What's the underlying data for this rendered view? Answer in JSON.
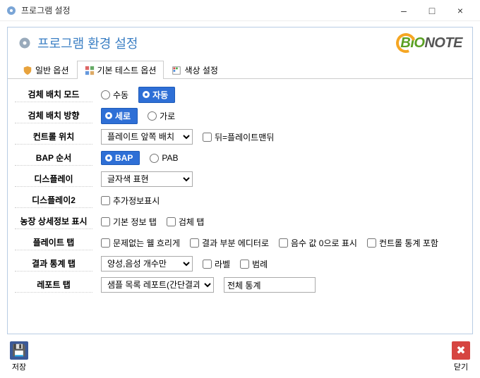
{
  "window": {
    "title": "프로그램 설정",
    "minimize": "–",
    "maximize": "□",
    "close": "×"
  },
  "header": {
    "title": "프로그램 환경 설정",
    "logo_bio": "BIO",
    "logo_note": "NOTE"
  },
  "tabs": {
    "general": "일반 옵션",
    "basic_test": "기본 테스트 옵션",
    "color": "색상 설정"
  },
  "form": {
    "placement_mode": {
      "label": "검체 배치 모드",
      "manual": "수동",
      "auto": "자동"
    },
    "placement_dir": {
      "label": "검체 배치 방향",
      "vertical": "세로",
      "horizontal": "가로"
    },
    "control_pos": {
      "label": "컨트롤 위치",
      "selected": "플레이트 앞쪽 배치",
      "options": [
        "플레이트 앞쪽 배치"
      ],
      "back_chk": "뒤=플레이트맨뒤"
    },
    "bap_order": {
      "label": "BAP 순서",
      "bap": "BAP",
      "pab": "PAB"
    },
    "display": {
      "label": "디스플레이",
      "selected": "글자색 표현",
      "options": [
        "글자색 표현"
      ]
    },
    "display2": {
      "label": "디스플레이2",
      "extra": "추가정보표시"
    },
    "farm_detail": {
      "label": "농장 상세정보 표시",
      "basic": "기본 정보 탭",
      "sample": "검체 탭"
    },
    "plate_tab": {
      "label": "플레이트 탭",
      "blur": "문제없는 웰 흐리게",
      "editor": "결과 부분 에디터로",
      "zero": "음수 값 0으로 표시",
      "ctrl_stat": "컨트롤 통계 포함"
    },
    "stats_tab": {
      "label": "결과 통계 탭",
      "selected": "양성,음성 개수만",
      "options": [
        "양성,음성 개수만"
      ],
      "label_chk": "라벨",
      "legend_chk": "범례"
    },
    "report_tab": {
      "label": "레포트 탭",
      "selected": "샘플 목록 레포트(간단결과)",
      "options": [
        "샘플 목록 레포트(간단결과)"
      ],
      "text_value": "전체 통계"
    }
  },
  "footer": {
    "save": "저장",
    "close": "닫기"
  }
}
